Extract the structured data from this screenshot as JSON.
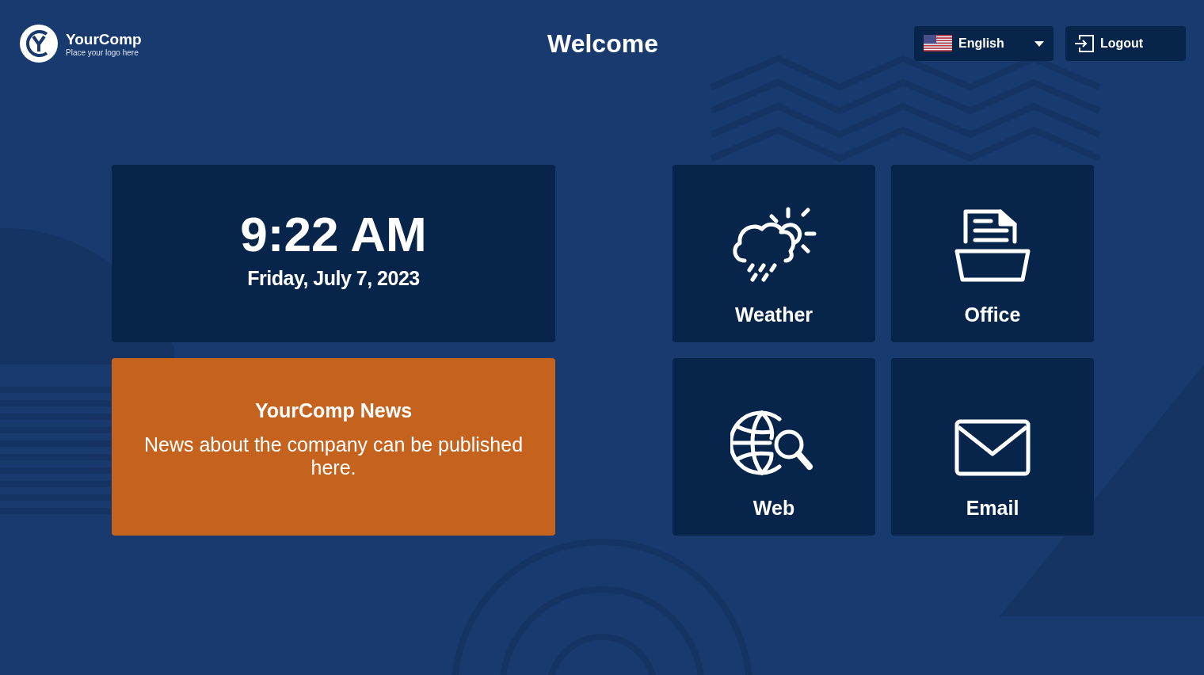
{
  "header": {
    "logo": {
      "name": "YourComp",
      "tagline": "Place your logo here"
    },
    "title": "Welcome",
    "language": {
      "label": "English"
    },
    "logout": {
      "label": "Logout"
    }
  },
  "clock": {
    "time": "9:22 AM",
    "date": "Friday, July 7, 2023"
  },
  "news": {
    "title": "YourComp News",
    "body": "News about the company can be published here."
  },
  "tiles": [
    {
      "kind": "weather",
      "label": "Weather"
    },
    {
      "kind": "office",
      "label": "Office"
    },
    {
      "kind": "web",
      "label": "Web"
    },
    {
      "kind": "email",
      "label": "Email"
    }
  ]
}
